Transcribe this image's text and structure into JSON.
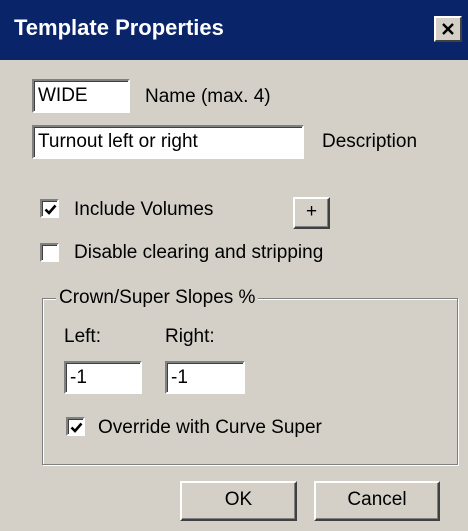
{
  "dialog": {
    "title": "Template Properties",
    "close_label": "close",
    "colors": {
      "titlebar": "#0a246a",
      "face": "#d4d0c8"
    }
  },
  "name_field": {
    "value": "WIDE",
    "label": "Name (max. 4)"
  },
  "description_field": {
    "value": "Turnout left or right",
    "label": "Description"
  },
  "include_volumes": {
    "label": "Include Volumes",
    "checked": true,
    "plus_label": "+"
  },
  "disable_clearing": {
    "label": "Disable clearing and stripping",
    "checked": false
  },
  "crown_group": {
    "title": "Crown/Super Slopes %",
    "left_label": "Left:",
    "right_label": "Right:",
    "left_value": "-1",
    "right_value": "-1",
    "override_label": "Override with Curve Super",
    "override_checked": true
  },
  "buttons": {
    "ok": "OK",
    "cancel": "Cancel"
  }
}
